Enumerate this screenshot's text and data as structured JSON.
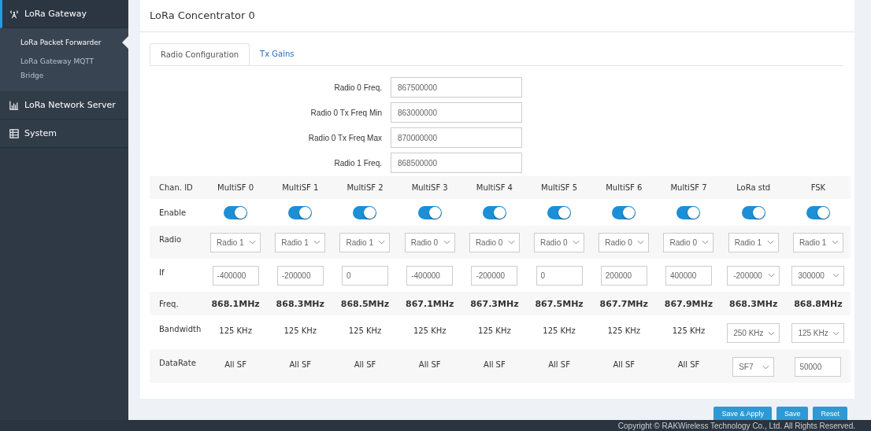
{
  "sidebar": {
    "items": [
      {
        "label": "LoRa Gateway",
        "selected": true,
        "children": [
          {
            "label": "LoRa Packet Forwarder",
            "selected": true
          },
          {
            "label": "LoRa Gateway MQTT Bridge",
            "selected": false
          }
        ]
      },
      {
        "label": "LoRa Network Server",
        "selected": false
      },
      {
        "label": "System",
        "selected": false
      }
    ]
  },
  "page": {
    "title": "LoRa Concentrator 0"
  },
  "tabs": [
    {
      "label": "Radio Configuration",
      "selected": true
    },
    {
      "label": "Tx Gains",
      "selected": false
    }
  ],
  "radio_fields": [
    {
      "label": "Radio 0 Freq.",
      "value": "867500000"
    },
    {
      "label": "Radio 0 Tx Freq Min",
      "value": "863000000"
    },
    {
      "label": "Radio 0 Tx Freq Max",
      "value": "870000000"
    },
    {
      "label": "Radio 1 Freq.",
      "value": "868500000"
    }
  ],
  "row_labels": [
    "Chan. ID",
    "Enable",
    "Radio",
    "If",
    "Freq.",
    "Bandwidth",
    "DataRate"
  ],
  "channels": [
    {
      "id": "MultiSF 0",
      "enabled": true,
      "radio": "Radio 1",
      "if": {
        "kind": "input",
        "value": "-400000"
      },
      "freq": "868.1MHz",
      "bandwidth": {
        "kind": "text",
        "value": "125 KHz"
      },
      "datarate": {
        "kind": "text",
        "value": "All SF"
      }
    },
    {
      "id": "MultiSF 1",
      "enabled": true,
      "radio": "Radio 1",
      "if": {
        "kind": "input",
        "value": "-200000"
      },
      "freq": "868.3MHz",
      "bandwidth": {
        "kind": "text",
        "value": "125 KHz"
      },
      "datarate": {
        "kind": "text",
        "value": "All SF"
      }
    },
    {
      "id": "MultiSF 2",
      "enabled": true,
      "radio": "Radio 1",
      "if": {
        "kind": "input",
        "value": "0"
      },
      "freq": "868.5MHz",
      "bandwidth": {
        "kind": "text",
        "value": "125 KHz"
      },
      "datarate": {
        "kind": "text",
        "value": "All SF"
      }
    },
    {
      "id": "MultiSF 3",
      "enabled": true,
      "radio": "Radio 0",
      "if": {
        "kind": "input",
        "value": "-400000"
      },
      "freq": "867.1MHz",
      "bandwidth": {
        "kind": "text",
        "value": "125 KHz"
      },
      "datarate": {
        "kind": "text",
        "value": "All SF"
      }
    },
    {
      "id": "MultiSF 4",
      "enabled": true,
      "radio": "Radio 0",
      "if": {
        "kind": "input",
        "value": "-200000"
      },
      "freq": "867.3MHz",
      "bandwidth": {
        "kind": "text",
        "value": "125 KHz"
      },
      "datarate": {
        "kind": "text",
        "value": "All SF"
      }
    },
    {
      "id": "MultiSF 5",
      "enabled": true,
      "radio": "Radio 0",
      "if": {
        "kind": "input",
        "value": "0"
      },
      "freq": "867.5MHz",
      "bandwidth": {
        "kind": "text",
        "value": "125 KHz"
      },
      "datarate": {
        "kind": "text",
        "value": "All SF"
      }
    },
    {
      "id": "MultiSF 6",
      "enabled": true,
      "radio": "Radio 0",
      "if": {
        "kind": "input",
        "value": "200000"
      },
      "freq": "867.7MHz",
      "bandwidth": {
        "kind": "text",
        "value": "125 KHz"
      },
      "datarate": {
        "kind": "text",
        "value": "All SF"
      }
    },
    {
      "id": "MultiSF 7",
      "enabled": true,
      "radio": "Radio 0",
      "if": {
        "kind": "input",
        "value": "400000"
      },
      "freq": "867.9MHz",
      "bandwidth": {
        "kind": "text",
        "value": "125 KHz"
      },
      "datarate": {
        "kind": "text",
        "value": "All SF"
      }
    },
    {
      "id": "LoRa std",
      "enabled": true,
      "radio": "Radio 1",
      "if": {
        "kind": "select",
        "value": "-200000"
      },
      "freq": "868.3MHz",
      "bandwidth": {
        "kind": "select",
        "value": "250 KHz"
      },
      "datarate": {
        "kind": "select",
        "value": "SF7"
      }
    },
    {
      "id": "FSK",
      "enabled": true,
      "radio": "Radio 1",
      "if": {
        "kind": "select",
        "value": "300000"
      },
      "freq": "868.8MHz",
      "bandwidth": {
        "kind": "select",
        "value": "125 KHz"
      },
      "datarate": {
        "kind": "input",
        "value": "50000"
      }
    }
  ],
  "buttons": [
    "Save & Apply",
    "Save",
    "Reset"
  ],
  "footer": "Copyright © RAKWireless Technology Co., Ltd. All Rights Reserved."
}
